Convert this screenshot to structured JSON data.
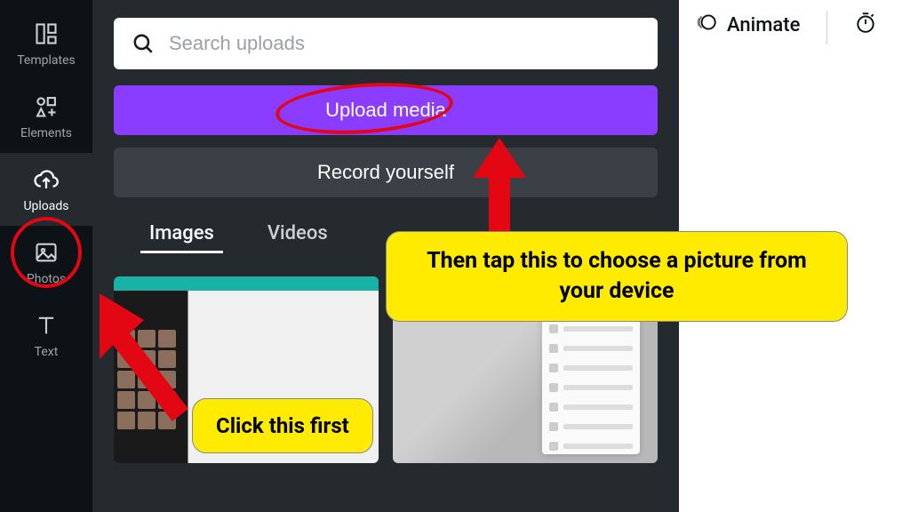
{
  "sidebar": {
    "items": [
      {
        "label": "Templates"
      },
      {
        "label": "Elements"
      },
      {
        "label": "Uploads"
      },
      {
        "label": "Photos"
      },
      {
        "label": "Text"
      }
    ]
  },
  "panel": {
    "search_placeholder": "Search uploads",
    "upload_label": "Upload media",
    "record_label": "Record yourself",
    "tabs": [
      {
        "label": "Images"
      },
      {
        "label": "Videos"
      }
    ]
  },
  "toolbar": {
    "animate_label": "Animate"
  },
  "annotations": {
    "callout1": "Click this first",
    "callout2": "Then tap this to choose a picture from your device"
  }
}
